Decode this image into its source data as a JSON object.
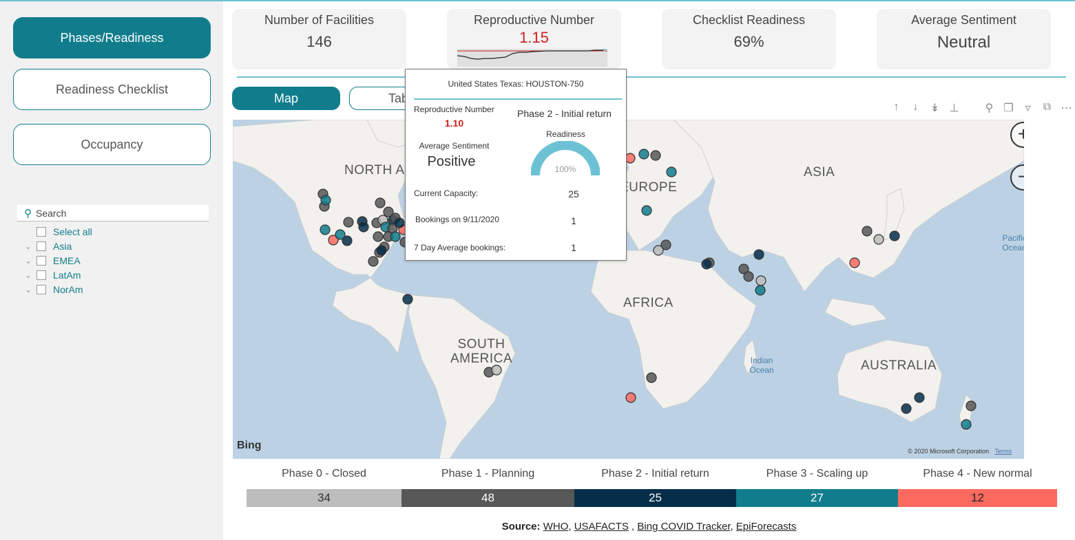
{
  "sidebar": {
    "nav": [
      {
        "label": "Phases/Readiness",
        "active": true
      },
      {
        "label": "Readiness Checklist",
        "active": false
      },
      {
        "label": "Occupancy",
        "active": false
      }
    ],
    "slicer": {
      "search_placeholder": "Search",
      "items": [
        "Select all",
        "Asia",
        "EMEA",
        "LatAm",
        "NorAm"
      ]
    }
  },
  "kpis": [
    {
      "label": "Number of Facilities",
      "value": "146"
    },
    {
      "label": "Reproductive Number",
      "value": "1.15"
    },
    {
      "label": "Checklist Readiness",
      "value": "69%"
    },
    {
      "label": "Average Sentiment",
      "value": "Neutral"
    }
  ],
  "tabs": [
    {
      "label": "Map",
      "active": true
    },
    {
      "label": "Table",
      "active": false
    }
  ],
  "map": {
    "continent_labels": [
      "NORTH AMERICA",
      "EUROPE",
      "ASIA",
      "AFRICA",
      "SOUTH AMERICA",
      "AUSTRALIA"
    ],
    "ocean_labels": [
      "Pacific Ocean",
      "Indian Ocean"
    ],
    "attribution": "Bing",
    "copyright": "© 2020 Microsoft Corporation",
    "terms": "Terms"
  },
  "tooltip": {
    "title": "United States Texas: HOUSTON-750",
    "repro_label": "Reproductive Number",
    "repro_value": "1.10",
    "phase": "Phase 2 - Initial return",
    "readiness_label": "Readiness",
    "readiness_value": "100%",
    "sentiment_label": "Average Sentiment",
    "sentiment_value": "Positive",
    "rows": [
      {
        "label": "Current Capacity:",
        "value": "25"
      },
      {
        "label": "Bookings on 9/11/2020",
        "value": "1"
      },
      {
        "label": "7 Day Average bookings:",
        "value": "1"
      }
    ]
  },
  "phases": [
    {
      "label": "Phase 0 - Closed",
      "count": "34",
      "color": "#bdbdbd"
    },
    {
      "label": "Phase 1 - Planning",
      "count": "48",
      "color": "#575757"
    },
    {
      "label": "Phase 2 - Initial return",
      "count": "25",
      "color": "#062e4a"
    },
    {
      "label": "Phase 3 - Scaling up",
      "count": "27",
      "color": "#117d8c"
    },
    {
      "label": "Phase 4 - New normal",
      "count": "12",
      "color": "#fb6a5f"
    }
  ],
  "source": {
    "prefix": "Source:",
    "links": [
      "WHO",
      "USAFACTS",
      "Bing COVID Tracker",
      "EpiForecasts"
    ]
  },
  "colors": {
    "accent": "#117d8c",
    "divider": "#6cc2d4",
    "red_value": "#cc1e1e"
  }
}
